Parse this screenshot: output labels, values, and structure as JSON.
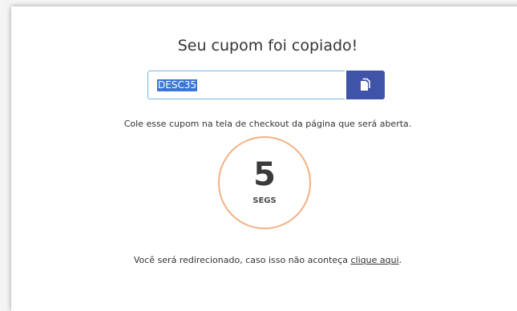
{
  "modal": {
    "title": "Seu cupom foi copiado!",
    "coupon_code": "DESC35",
    "instructions": "Cole esse cupom na tela de checkout da página que será aberta.",
    "countdown": {
      "number": "5",
      "unit": "SEGS"
    },
    "redirect": {
      "prefix": "Você será redirecionado, caso isso não aconteça ",
      "link": "clique aqui",
      "suffix": "."
    }
  },
  "icons": {
    "copy": "copy-icon"
  },
  "colors": {
    "copy_button": "#3f53a8",
    "input_border": "#6fb7ea",
    "selection": "#3a76d8",
    "countdown_ring": "#f1b082"
  }
}
